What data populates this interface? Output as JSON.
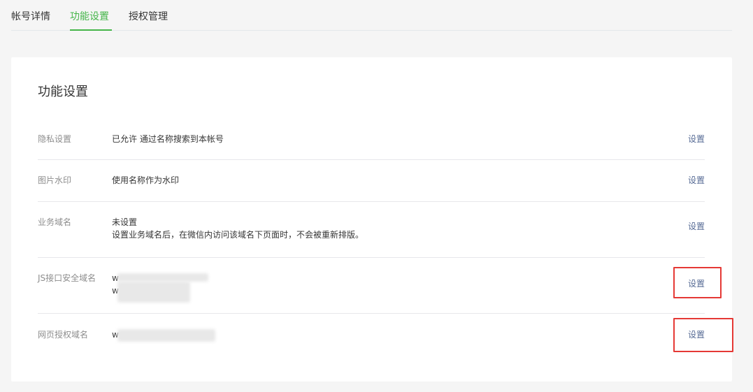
{
  "tabs": [
    {
      "label": "帐号详情",
      "active": false
    },
    {
      "label": "功能设置",
      "active": true
    },
    {
      "label": "授权管理",
      "active": false
    }
  ],
  "section": {
    "title": "功能设置"
  },
  "settings": [
    {
      "label": "隐私设置",
      "value": "已允许 通过名称搜索到本帐号",
      "desc": "",
      "action": "设置"
    },
    {
      "label": "图片水印",
      "value": "使用名称作为水印",
      "desc": "",
      "action": "设置"
    },
    {
      "label": "业务域名",
      "value": "未设置",
      "desc": "设置业务域名后，在微信内访问该域名下页面时，不会被重新排版。",
      "action": "设置"
    },
    {
      "label": "JS接口安全域名",
      "value": "w",
      "value2": "w",
      "desc": "",
      "action": "设置",
      "highlighted": true
    },
    {
      "label": "网页授权域名",
      "value": "w",
      "desc": "",
      "action": "设置",
      "highlighted": true
    }
  ],
  "colors": {
    "accent": "#44b549",
    "link": "#576b95",
    "highlight": "#e53935"
  }
}
